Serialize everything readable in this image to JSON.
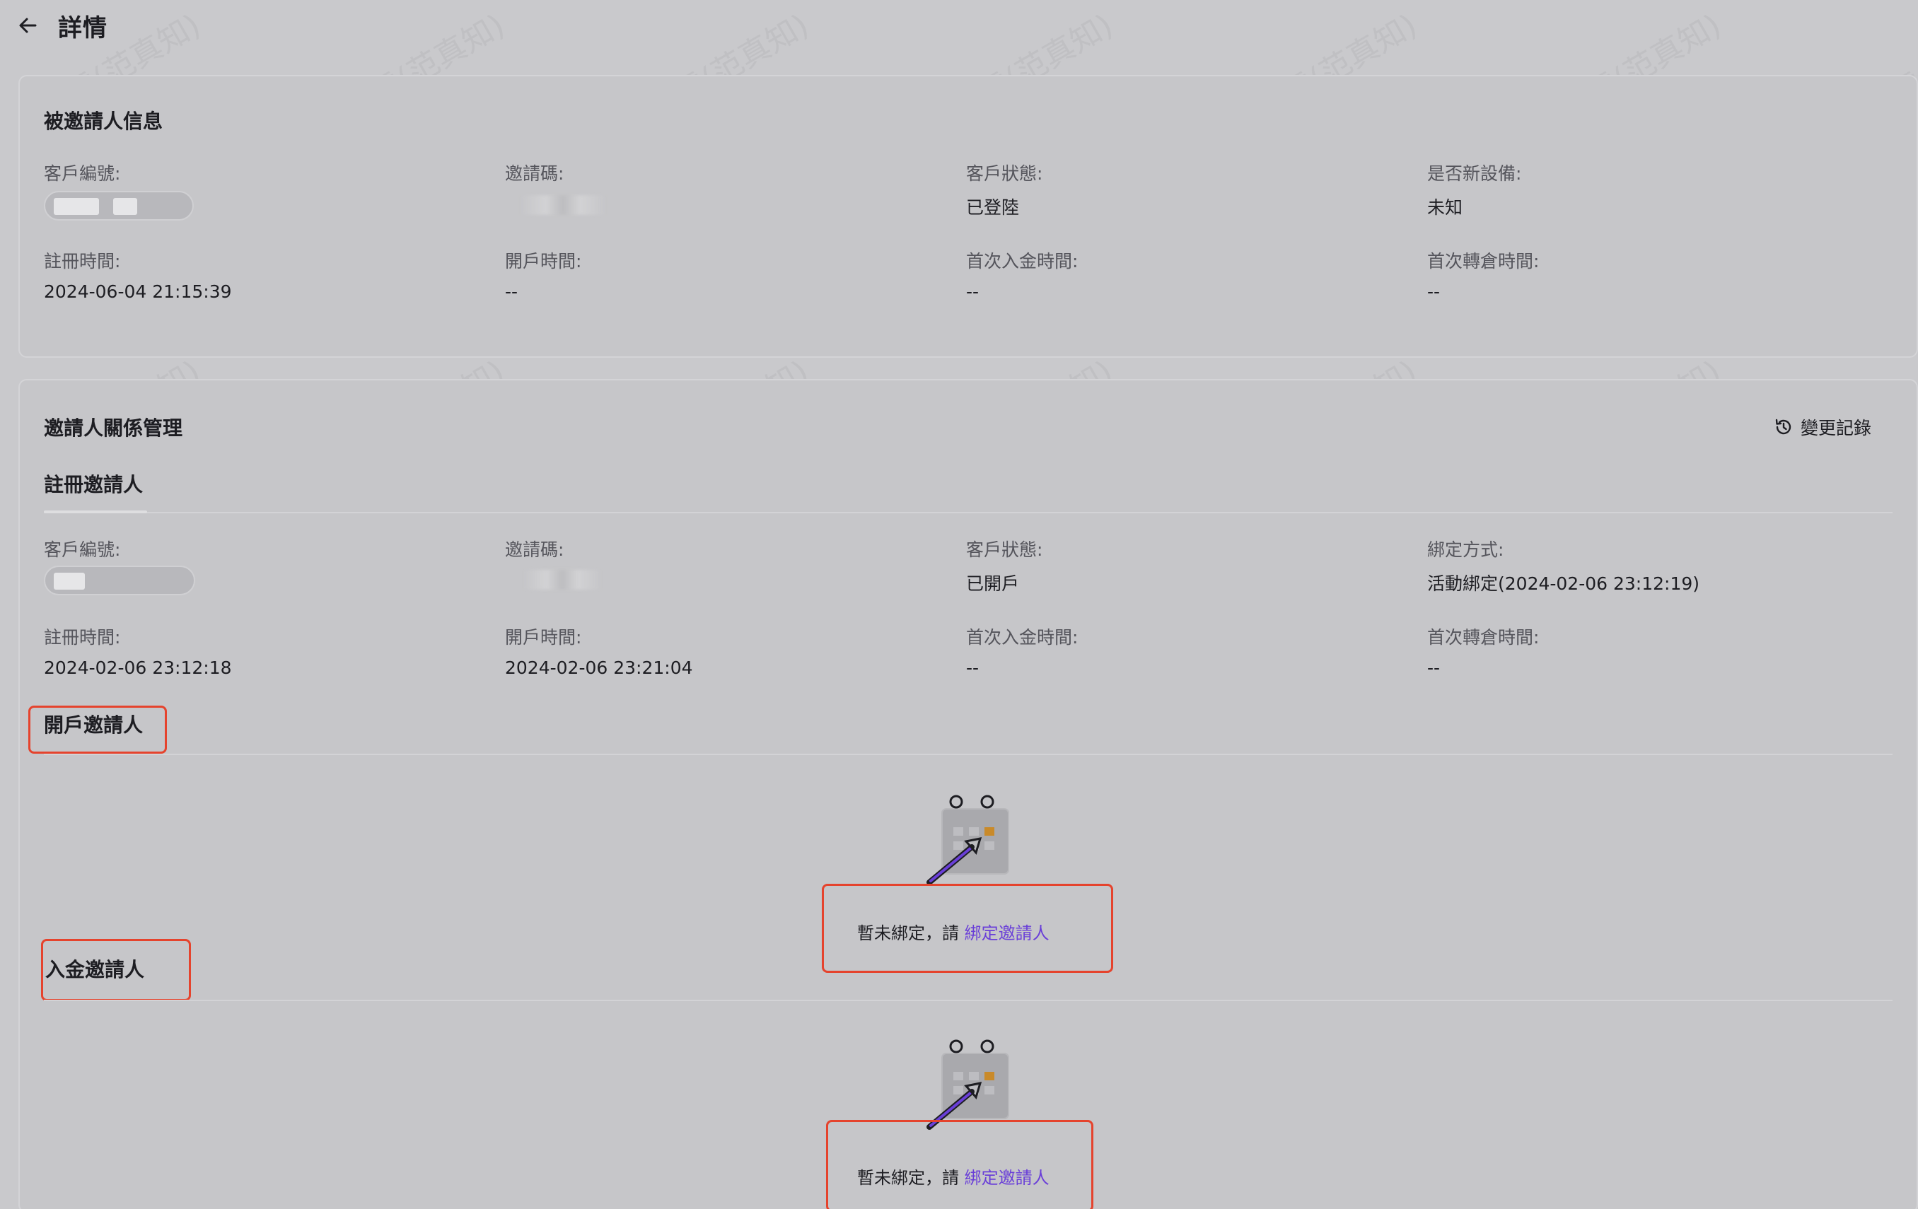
{
  "header": {
    "title": "詳情"
  },
  "invitee": {
    "section_title": "被邀請人信息",
    "customer_no_label": "客戶編號:",
    "invite_code_label": "邀請碼:",
    "status_label": "客戶狀態:",
    "status_value": "已登陸",
    "new_device_label": "是否新設備:",
    "new_device_value": "未知",
    "register_time_label": "註冊時間:",
    "register_time_value": "2024-06-04 21:15:39",
    "open_time_label": "開戶時間:",
    "open_time_value": "--",
    "first_deposit_label": "首次入金時間:",
    "first_deposit_value": "--",
    "first_transfer_label": "首次轉倉時間:",
    "first_transfer_value": "--"
  },
  "relation": {
    "section_title": "邀請人關係管理",
    "history_label": "變更記錄",
    "register_tab": "註冊邀請人",
    "register": {
      "customer_no_label": "客戶編號:",
      "invite_code_label": "邀請碼:",
      "status_label": "客戶狀態:",
      "status_value": "已開戶",
      "bind_method_label": "綁定方式:",
      "bind_method_value": "活動綁定(2024-02-06 23:12:19)",
      "register_time_label": "註冊時間:",
      "register_time_value": "2024-02-06 23:12:18",
      "open_time_label": "開戶時間:",
      "open_time_value": "2024-02-06 23:21:04",
      "first_deposit_label": "首次入金時間:",
      "first_deposit_value": "--",
      "first_transfer_label": "首次轉倉時間:",
      "first_transfer_value": "--"
    },
    "open_account_inviter": {
      "title": "開戶邀請人",
      "empty_text": "暫未綁定，請 ",
      "bind_link": "綁定邀請人"
    },
    "deposit_inviter": {
      "title": "入金邀請人",
      "empty_text": "暫未綁定，請 ",
      "bind_link": "綁定邀請人"
    }
  },
  "watermark": "青雪(范真知)",
  "colors": {
    "highlight": "#e5432d",
    "link": "#6a3fd8",
    "background": "#c9c9cc"
  }
}
